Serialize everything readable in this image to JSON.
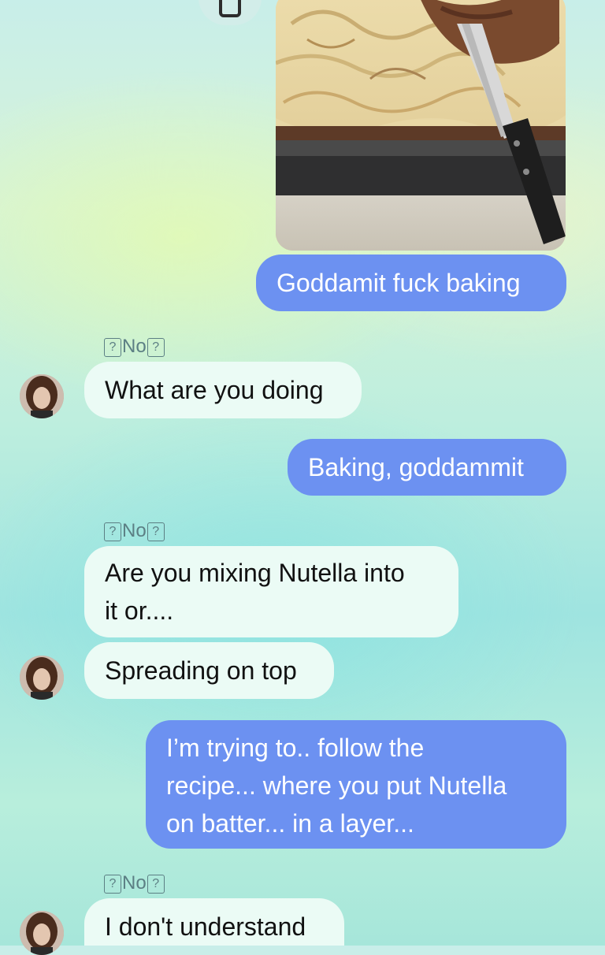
{
  "top_button": {
    "icon": "phone-icon"
  },
  "photo": {
    "description_icon": "photo-attachment"
  },
  "messages": [
    {
      "direction": "out",
      "text": "Goddamit fuck baking"
    },
    {
      "direction": "in",
      "sender_text": "No",
      "text": "What are you doing"
    },
    {
      "direction": "out",
      "text": "Baking, goddammit"
    },
    {
      "direction": "in",
      "sender_text": "No",
      "text": "Are you mixing Nutella into\nit or...."
    },
    {
      "direction": "in",
      "text": "Spreading on top"
    },
    {
      "direction": "out",
      "text": "I’m trying to.. follow the\nrecipe... where you put Nutella\non batter... in a layer..."
    },
    {
      "direction": "in",
      "sender_text": "No",
      "text": "I don't understand"
    }
  ],
  "glyphs": {
    "unknown_char": "?"
  },
  "colors": {
    "outgoing_bubble": "#6c91f1",
    "incoming_bubble": "#ebfbf5"
  }
}
